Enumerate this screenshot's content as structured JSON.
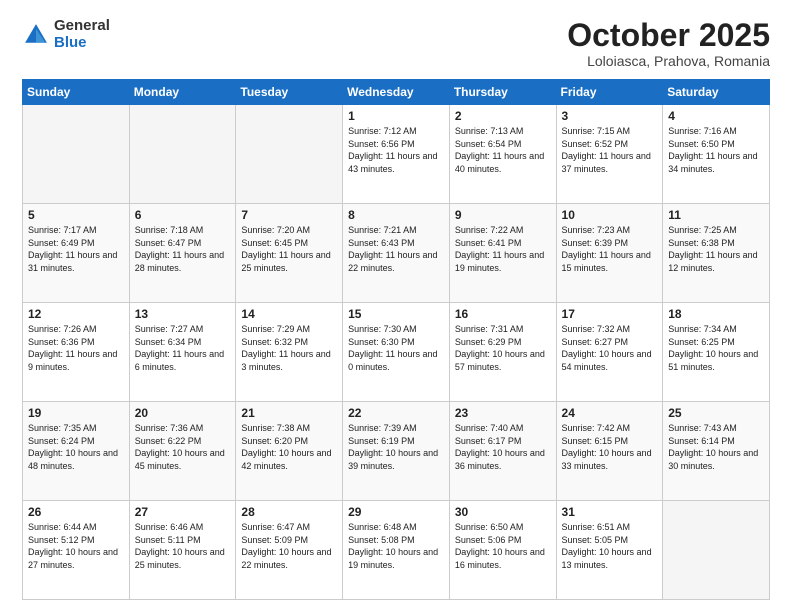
{
  "logo": {
    "general": "General",
    "blue": "Blue"
  },
  "title": "October 2025",
  "subtitle": "Loloiasca, Prahova, Romania",
  "days_of_week": [
    "Sunday",
    "Monday",
    "Tuesday",
    "Wednesday",
    "Thursday",
    "Friday",
    "Saturday"
  ],
  "weeks": [
    [
      {
        "day": "",
        "sunrise": "",
        "sunset": "",
        "daylight": "",
        "empty": true
      },
      {
        "day": "",
        "sunrise": "",
        "sunset": "",
        "daylight": "",
        "empty": true
      },
      {
        "day": "",
        "sunrise": "",
        "sunset": "",
        "daylight": "",
        "empty": true
      },
      {
        "day": "1",
        "sunrise": "Sunrise: 7:12 AM",
        "sunset": "Sunset: 6:56 PM",
        "daylight": "Daylight: 11 hours and 43 minutes."
      },
      {
        "day": "2",
        "sunrise": "Sunrise: 7:13 AM",
        "sunset": "Sunset: 6:54 PM",
        "daylight": "Daylight: 11 hours and 40 minutes."
      },
      {
        "day": "3",
        "sunrise": "Sunrise: 7:15 AM",
        "sunset": "Sunset: 6:52 PM",
        "daylight": "Daylight: 11 hours and 37 minutes."
      },
      {
        "day": "4",
        "sunrise": "Sunrise: 7:16 AM",
        "sunset": "Sunset: 6:50 PM",
        "daylight": "Daylight: 11 hours and 34 minutes."
      }
    ],
    [
      {
        "day": "5",
        "sunrise": "Sunrise: 7:17 AM",
        "sunset": "Sunset: 6:49 PM",
        "daylight": "Daylight: 11 hours and 31 minutes."
      },
      {
        "day": "6",
        "sunrise": "Sunrise: 7:18 AM",
        "sunset": "Sunset: 6:47 PM",
        "daylight": "Daylight: 11 hours and 28 minutes."
      },
      {
        "day": "7",
        "sunrise": "Sunrise: 7:20 AM",
        "sunset": "Sunset: 6:45 PM",
        "daylight": "Daylight: 11 hours and 25 minutes."
      },
      {
        "day": "8",
        "sunrise": "Sunrise: 7:21 AM",
        "sunset": "Sunset: 6:43 PM",
        "daylight": "Daylight: 11 hours and 22 minutes."
      },
      {
        "day": "9",
        "sunrise": "Sunrise: 7:22 AM",
        "sunset": "Sunset: 6:41 PM",
        "daylight": "Daylight: 11 hours and 19 minutes."
      },
      {
        "day": "10",
        "sunrise": "Sunrise: 7:23 AM",
        "sunset": "Sunset: 6:39 PM",
        "daylight": "Daylight: 11 hours and 15 minutes."
      },
      {
        "day": "11",
        "sunrise": "Sunrise: 7:25 AM",
        "sunset": "Sunset: 6:38 PM",
        "daylight": "Daylight: 11 hours and 12 minutes."
      }
    ],
    [
      {
        "day": "12",
        "sunrise": "Sunrise: 7:26 AM",
        "sunset": "Sunset: 6:36 PM",
        "daylight": "Daylight: 11 hours and 9 minutes."
      },
      {
        "day": "13",
        "sunrise": "Sunrise: 7:27 AM",
        "sunset": "Sunset: 6:34 PM",
        "daylight": "Daylight: 11 hours and 6 minutes."
      },
      {
        "day": "14",
        "sunrise": "Sunrise: 7:29 AM",
        "sunset": "Sunset: 6:32 PM",
        "daylight": "Daylight: 11 hours and 3 minutes."
      },
      {
        "day": "15",
        "sunrise": "Sunrise: 7:30 AM",
        "sunset": "Sunset: 6:30 PM",
        "daylight": "Daylight: 11 hours and 0 minutes."
      },
      {
        "day": "16",
        "sunrise": "Sunrise: 7:31 AM",
        "sunset": "Sunset: 6:29 PM",
        "daylight": "Daylight: 10 hours and 57 minutes."
      },
      {
        "day": "17",
        "sunrise": "Sunrise: 7:32 AM",
        "sunset": "Sunset: 6:27 PM",
        "daylight": "Daylight: 10 hours and 54 minutes."
      },
      {
        "day": "18",
        "sunrise": "Sunrise: 7:34 AM",
        "sunset": "Sunset: 6:25 PM",
        "daylight": "Daylight: 10 hours and 51 minutes."
      }
    ],
    [
      {
        "day": "19",
        "sunrise": "Sunrise: 7:35 AM",
        "sunset": "Sunset: 6:24 PM",
        "daylight": "Daylight: 10 hours and 48 minutes."
      },
      {
        "day": "20",
        "sunrise": "Sunrise: 7:36 AM",
        "sunset": "Sunset: 6:22 PM",
        "daylight": "Daylight: 10 hours and 45 minutes."
      },
      {
        "day": "21",
        "sunrise": "Sunrise: 7:38 AM",
        "sunset": "Sunset: 6:20 PM",
        "daylight": "Daylight: 10 hours and 42 minutes."
      },
      {
        "day": "22",
        "sunrise": "Sunrise: 7:39 AM",
        "sunset": "Sunset: 6:19 PM",
        "daylight": "Daylight: 10 hours and 39 minutes."
      },
      {
        "day": "23",
        "sunrise": "Sunrise: 7:40 AM",
        "sunset": "Sunset: 6:17 PM",
        "daylight": "Daylight: 10 hours and 36 minutes."
      },
      {
        "day": "24",
        "sunrise": "Sunrise: 7:42 AM",
        "sunset": "Sunset: 6:15 PM",
        "daylight": "Daylight: 10 hours and 33 minutes."
      },
      {
        "day": "25",
        "sunrise": "Sunrise: 7:43 AM",
        "sunset": "Sunset: 6:14 PM",
        "daylight": "Daylight: 10 hours and 30 minutes."
      }
    ],
    [
      {
        "day": "26",
        "sunrise": "Sunrise: 6:44 AM",
        "sunset": "Sunset: 5:12 PM",
        "daylight": "Daylight: 10 hours and 27 minutes."
      },
      {
        "day": "27",
        "sunrise": "Sunrise: 6:46 AM",
        "sunset": "Sunset: 5:11 PM",
        "daylight": "Daylight: 10 hours and 25 minutes."
      },
      {
        "day": "28",
        "sunrise": "Sunrise: 6:47 AM",
        "sunset": "Sunset: 5:09 PM",
        "daylight": "Daylight: 10 hours and 22 minutes."
      },
      {
        "day": "29",
        "sunrise": "Sunrise: 6:48 AM",
        "sunset": "Sunset: 5:08 PM",
        "daylight": "Daylight: 10 hours and 19 minutes."
      },
      {
        "day": "30",
        "sunrise": "Sunrise: 6:50 AM",
        "sunset": "Sunset: 5:06 PM",
        "daylight": "Daylight: 10 hours and 16 minutes."
      },
      {
        "day": "31",
        "sunrise": "Sunrise: 6:51 AM",
        "sunset": "Sunset: 5:05 PM",
        "daylight": "Daylight: 10 hours and 13 minutes."
      },
      {
        "day": "",
        "sunrise": "",
        "sunset": "",
        "daylight": "",
        "empty": true
      }
    ]
  ]
}
